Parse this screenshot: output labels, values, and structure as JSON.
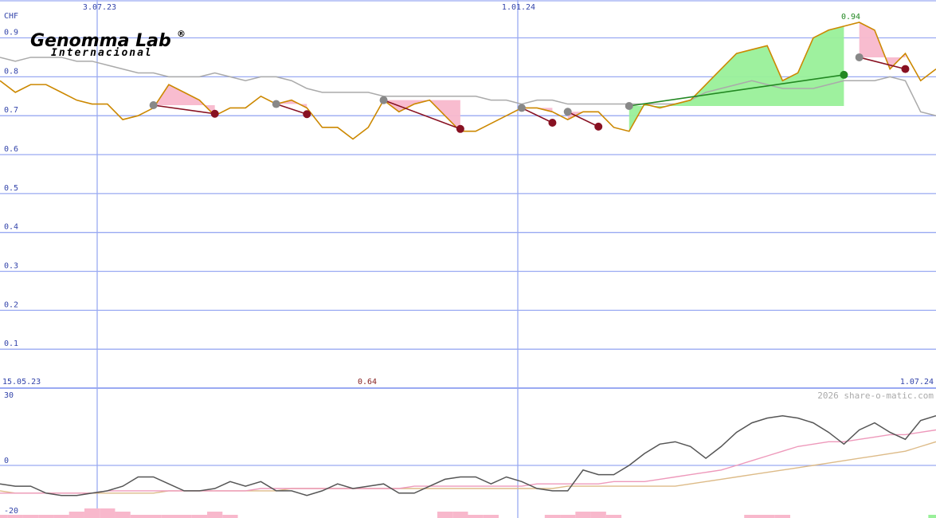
{
  "chart_data": [
    {
      "type": "line",
      "currency": "CHF",
      "ylim": [
        0,
        0.9
      ],
      "y_ticks": [
        "0.1",
        "0.2",
        "0.3",
        "0.4",
        "0.5",
        "0.6",
        "0.7",
        "0.8",
        "0.9"
      ],
      "x_date_labels": [
        "3.07.23",
        "1.01.24"
      ],
      "start_date": "15.05.23",
      "end_date": "1.07.24",
      "annotations": {
        "high": "0.94",
        "low": "0.64"
      },
      "series": [
        {
          "color": "#cc8800",
          "values": [
            0.79,
            0.76,
            0.78,
            0.78,
            0.76,
            0.74,
            0.73,
            0.73,
            0.69,
            0.7,
            0.72,
            0.78,
            0.76,
            0.74,
            0.7,
            0.72,
            0.72,
            0.75,
            0.73,
            0.74,
            0.72,
            0.67,
            0.67,
            0.64,
            0.67,
            0.74,
            0.71,
            0.73,
            0.74,
            0.7,
            0.66,
            0.66,
            0.68,
            0.7,
            0.72,
            0.72,
            0.71,
            0.69,
            0.71,
            0.71,
            0.67,
            0.66,
            0.73,
            0.72,
            0.73,
            0.74,
            0.78,
            0.82,
            0.86,
            0.87,
            0.88,
            0.79,
            0.81,
            0.9,
            0.92,
            0.93,
            0.94,
            0.92,
            0.82,
            0.86,
            0.79,
            0.82
          ]
        },
        {
          "color": "#aaaaaa",
          "values": [
            0.85,
            0.84,
            0.85,
            0.85,
            0.85,
            0.84,
            0.84,
            0.83,
            0.82,
            0.81,
            0.81,
            0.8,
            0.8,
            0.8,
            0.81,
            0.8,
            0.79,
            0.8,
            0.8,
            0.79,
            0.77,
            0.76,
            0.76,
            0.76,
            0.76,
            0.75,
            0.75,
            0.75,
            0.75,
            0.75,
            0.75,
            0.75,
            0.74,
            0.74,
            0.73,
            0.74,
            0.74,
            0.73,
            0.73,
            0.73,
            0.73,
            0.73,
            0.73,
            0.73,
            0.73,
            0.74,
            0.76,
            0.77,
            0.78,
            0.79,
            0.78,
            0.77,
            0.77,
            0.77,
            0.78,
            0.79,
            0.79,
            0.79,
            0.8,
            0.79,
            0.71,
            0.7
          ]
        }
      ],
      "trades": [
        {
          "buy": [
            10,
            0.727
          ],
          "sell": [
            14,
            0.705
          ],
          "outcome": "loss"
        },
        {
          "buy": [
            18,
            0.73
          ],
          "sell": [
            20,
            0.704
          ],
          "outcome": "loss"
        },
        {
          "buy": [
            25,
            0.74
          ],
          "sell": [
            30,
            0.666
          ],
          "outcome": "loss"
        },
        {
          "buy": [
            34,
            0.72
          ],
          "sell": [
            36,
            0.682
          ],
          "outcome": "loss"
        },
        {
          "buy": [
            37,
            0.71
          ],
          "sell": [
            39,
            0.672
          ],
          "outcome": "loss"
        },
        {
          "buy": [
            41,
            0.725
          ],
          "sell": [
            55,
            0.805
          ],
          "outcome": "gain"
        },
        {
          "buy": [
            56,
            0.85
          ],
          "sell": [
            59,
            0.82
          ],
          "outcome": "loss"
        }
      ]
    },
    {
      "type": "line",
      "ylim": [
        -20,
        30
      ],
      "y_ticks": [
        "30",
        "0",
        "-20"
      ],
      "series": [
        {
          "color": "#555555",
          "values": [
            -8,
            -9,
            -9,
            -12,
            -13,
            -13,
            -12,
            -11,
            -9,
            -5,
            -5,
            -8,
            -11,
            -11,
            -10,
            -7,
            -9,
            -7,
            -11,
            -11,
            -13,
            -11,
            -8,
            -10,
            -9,
            -8,
            -12,
            -12,
            -9,
            -6,
            -5,
            -5,
            -8,
            -5,
            -7,
            -10,
            -11,
            -11,
            -2,
            -4,
            -4,
            0,
            5,
            9,
            10,
            8,
            3,
            8,
            14,
            18,
            20,
            21,
            20,
            18,
            14,
            9,
            15,
            18,
            14,
            11,
            19,
            21
          ]
        },
        {
          "color": "#ee99bb",
          "values": [
            -12,
            -12,
            -12,
            -12,
            -12,
            -12,
            -12,
            -11,
            -11,
            -11,
            -11,
            -11,
            -11,
            -11,
            -11,
            -11,
            -11,
            -10,
            -10,
            -10,
            -10,
            -10,
            -10,
            -10,
            -10,
            -10,
            -10,
            -9,
            -9,
            -9,
            -9,
            -9,
            -9,
            -9,
            -9,
            -8,
            -8,
            -8,
            -8,
            -8,
            -7,
            -7,
            -7,
            -6,
            -5,
            -4,
            -3,
            -2,
            0,
            2,
            4,
            6,
            8,
            9,
            10,
            10,
            11,
            12,
            13,
            13,
            14,
            15
          ]
        },
        {
          "color": "#ddbb88",
          "values": [
            -11,
            -12,
            -12,
            -12,
            -12,
            -12,
            -12,
            -12,
            -12,
            -12,
            -12,
            -11,
            -11,
            -11,
            -11,
            -11,
            -11,
            -11,
            -11,
            -10,
            -10,
            -10,
            -10,
            -10,
            -10,
            -10,
            -10,
            -10,
            -10,
            -10,
            -10,
            -10,
            -10,
            -10,
            -10,
            -10,
            -10,
            -9,
            -9,
            -9,
            -9,
            -9,
            -9,
            -9,
            -9,
            -8,
            -7,
            -6,
            -5,
            -4,
            -3,
            -2,
            -1,
            0,
            1,
            2,
            3,
            4,
            5,
            6,
            8,
            10
          ]
        }
      ],
      "volume_bars": [
        1,
        1,
        1,
        1,
        1,
        2,
        3,
        3,
        2,
        1,
        1,
        1,
        1,
        1,
        2,
        1,
        0,
        0,
        0,
        0,
        0,
        0,
        0,
        0,
        0,
        0,
        0,
        0,
        0,
        2,
        2,
        1,
        1,
        0,
        0,
        0,
        1,
        1,
        2,
        2,
        1,
        0,
        0,
        0,
        0,
        0,
        0,
        0,
        0,
        1,
        1,
        1,
        0,
        0,
        0,
        0,
        0,
        0,
        0,
        0,
        0,
        1
      ]
    }
  ],
  "brand": {
    "name": "Genomma Lab",
    "mark": "®",
    "subtitle": "Internacional"
  },
  "credit": "2026 share-o-matic.com",
  "colors": {
    "grid": "#9aaaf2",
    "axis_text": "#3344aa",
    "high_label": "#228822",
    "low_label": "#882222",
    "gain_fill": "#99f099",
    "loss_fill": "#f8b8cc",
    "gain_line": "#228822",
    "loss_line": "#881122"
  }
}
